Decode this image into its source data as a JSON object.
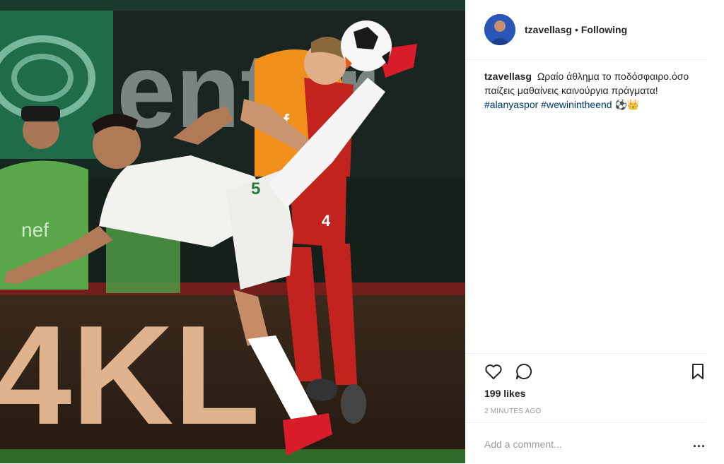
{
  "post": {
    "header": {
      "username": "tzavellasg",
      "separator": "•",
      "follow_status": "Following"
    },
    "caption": {
      "username": "tzavellasg",
      "text": "Ωραίο άθλημα το ποδόσφαιρο.όσο παίζεις μαθαίνεις καινούργια πράγματα!",
      "hashtag_1": "#alanyaspor",
      "hashtag_2": "#wewinintheend",
      "emoji": "⚽👑"
    },
    "actions": {
      "like_icon": "heart-icon",
      "comment_icon": "comment-bubble-icon",
      "save_icon": "bookmark-icon"
    },
    "likes": "199 likes",
    "timestamp": "2 MINUTES AGO",
    "comment": {
      "placeholder": "Add a comment...",
      "more": "..."
    },
    "photo": {
      "banner_left": "enter",
      "banner_bottom": "4KL",
      "sponsor": "nef",
      "shirt_sponsor": "Tef",
      "shirt_number_red": "4",
      "shirt_number_white": "5"
    }
  },
  "colors": {
    "link": "#003569",
    "muted": "#999999",
    "text": "#262626",
    "border": "#efefef"
  }
}
